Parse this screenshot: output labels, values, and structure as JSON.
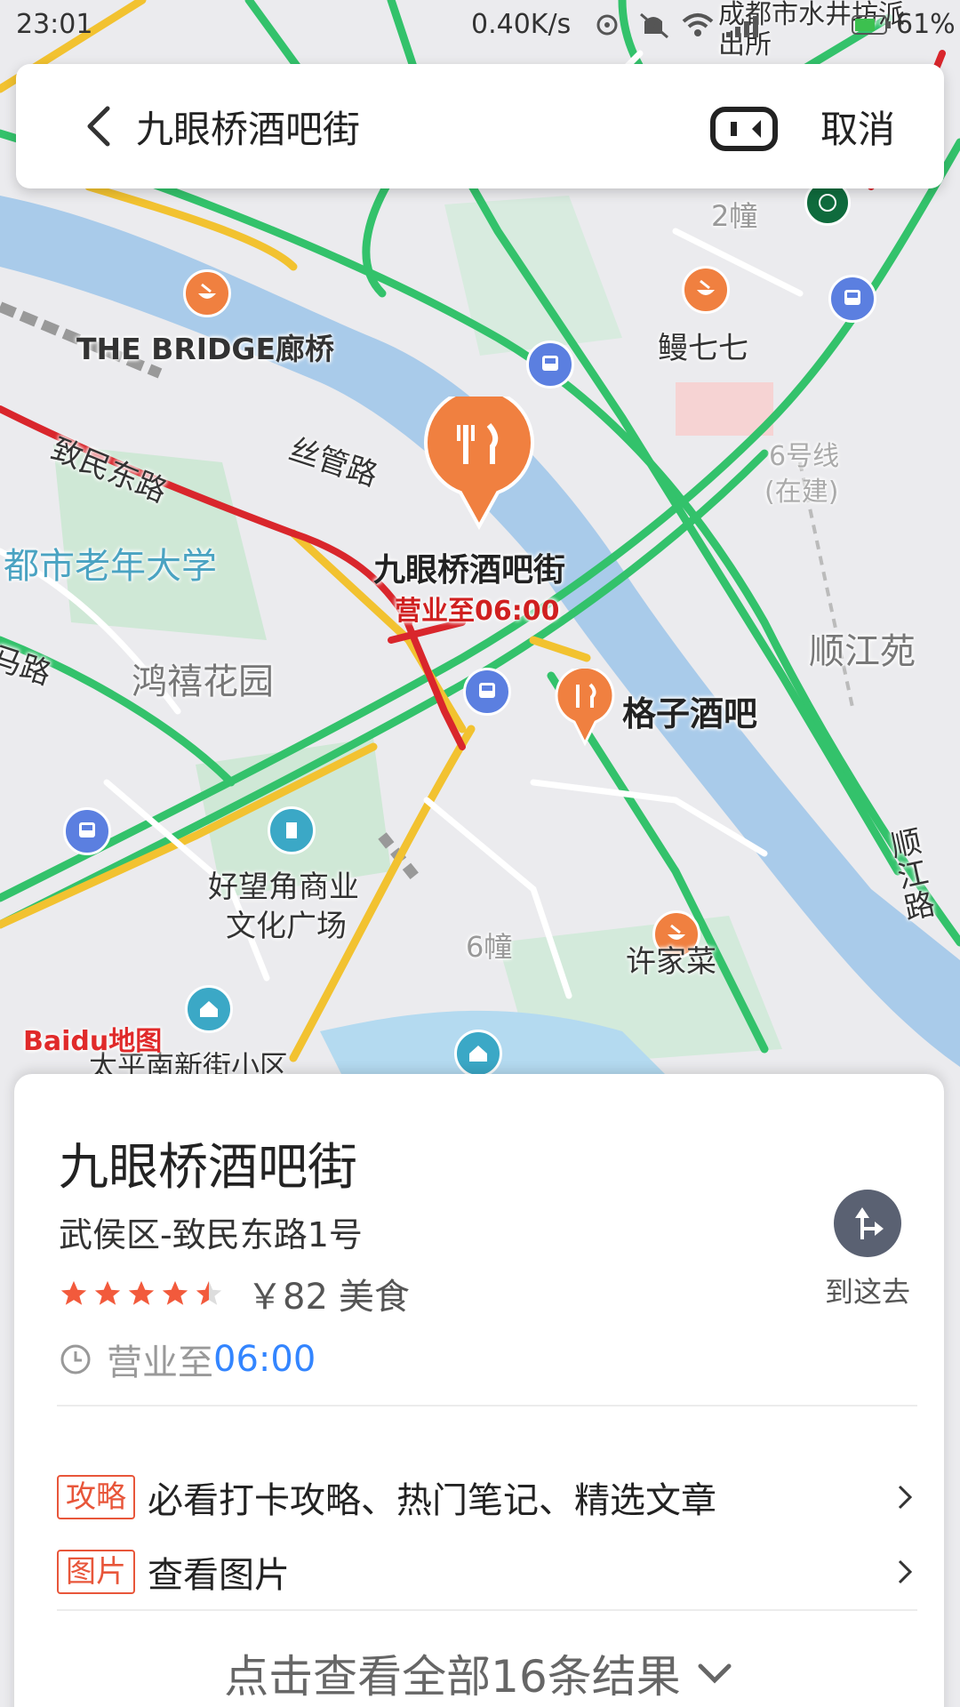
{
  "status_bar": {
    "time": "23:01",
    "network_speed": "0.40K/s",
    "battery": "61%"
  },
  "search": {
    "query": "九眼桥酒吧街",
    "cancel_label": "取消"
  },
  "map": {
    "labels": {
      "top_poi": "成都市水井坊派出所",
      "the_bridge": "THE BRIDGE廊桥",
      "man_qi_qi": "鳗七七",
      "building_2": "2幢",
      "line_6": "6号线",
      "line_6_status": "(在建)",
      "si_guan_lu": "丝管路",
      "zhi_min_dong_lu": "致民东路",
      "elder_university": "都市老年大学",
      "selected_poi": "九眼桥酒吧街",
      "selected_poi_hours": "营业至06:00",
      "shun_jiang_yuan": "顺江苑",
      "ma_lu": "马路",
      "hong_xi": "鸿禧花园",
      "gezi_bar": "格子酒吧",
      "haowangjiao": "好望角商业",
      "haowangjiao_2": "文化广场",
      "shun_jiang_lu": "顺江路",
      "building_6": "6幢",
      "xu_jia_cai": "许家菜",
      "taiping": "太平南新街小区",
      "baidu_logo": "Baidu地图"
    }
  },
  "result": {
    "name": "九眼桥酒吧街",
    "address": "武侯区-致民东路1号",
    "rating": 4.5,
    "price": "￥82",
    "category": "美食",
    "hours_prefix": "营业至",
    "hours_time": "06:00",
    "navigate_label": "到这去",
    "rows": [
      {
        "tag": "攻略",
        "text": "必看打卡攻略、热门笔记、精选文章"
      },
      {
        "tag": "图片",
        "text": "查看图片"
      }
    ],
    "more_results": "点击查看全部16条结果"
  },
  "colors": {
    "accent_blue": "#3385ff",
    "tag_red": "#e8563a",
    "star_red": "#f25a3c",
    "pin_orange": "#f08040",
    "river_blue": "#a9cbea",
    "road_green": "#33c26b"
  }
}
